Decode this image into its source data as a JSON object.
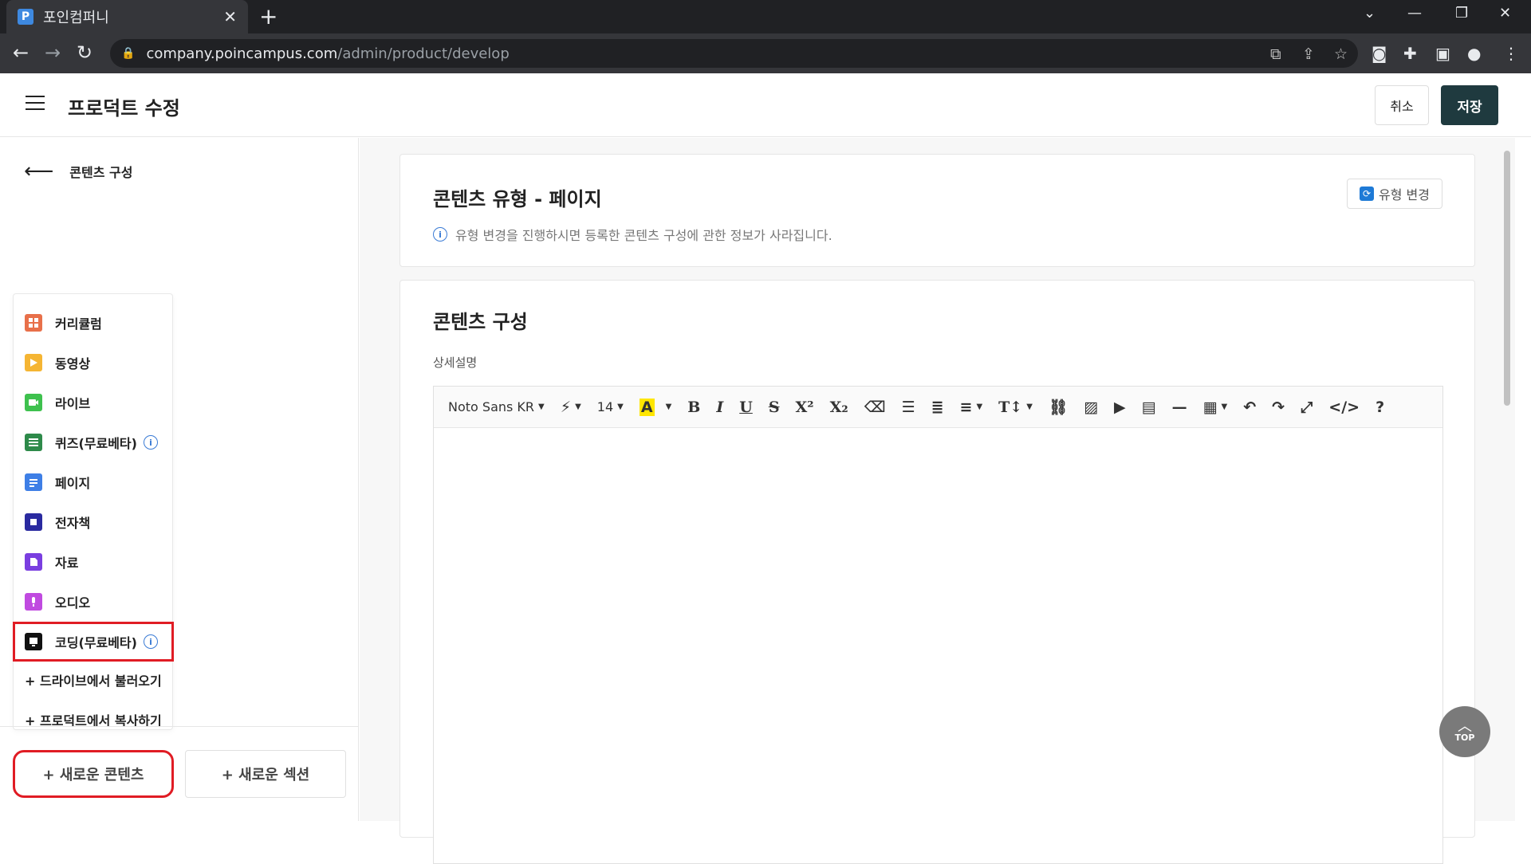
{
  "browser": {
    "tab_title": "포인컴퍼니",
    "favicon_letter": "P",
    "url_domain": "company.poincampus.com",
    "url_path": "/admin/product/develop"
  },
  "header": {
    "title": "프로덕트 수정",
    "cancel_label": "취소",
    "save_label": "저장"
  },
  "sidebar": {
    "back_label": "콘텐츠 구성",
    "items": [
      {
        "label": "커리큘럼",
        "color": "#e8704a"
      },
      {
        "label": "동영상",
        "color": "#f5b533"
      },
      {
        "label": "라이브",
        "color": "#3ec14e"
      },
      {
        "label": "퀴즈(무료베타)",
        "color": "#2e8a4a"
      },
      {
        "label": "페이지",
        "color": "#3e7fe6"
      },
      {
        "label": "전자책",
        "color": "#2a2aa0"
      },
      {
        "label": "자료",
        "color": "#7a3ee0"
      },
      {
        "label": "오디오",
        "color": "#c04ae0"
      },
      {
        "label": "코딩(무료베타)",
        "color": "#111111"
      }
    ],
    "info_mark": "i",
    "action_drive": "+ 드라이브에서 불러오기",
    "action_copy": "+ 프로덕트에서 복사하기",
    "new_content": "+ 새로운 콘텐츠",
    "new_section": "+ 새로운 섹션"
  },
  "content_type": {
    "title": "콘텐츠 유형 - 페이지",
    "change_button": "유형 변경",
    "notice": "유형 변경을 진행하시면 등록한 콘텐츠 구성에 관한 정보가 사라집니다."
  },
  "content_config": {
    "title": "콘텐츠 구성",
    "field_label": "상세설명",
    "toolbar": {
      "font": "Noto Sans KR",
      "size": "14",
      "font_color": "A",
      "bold": "B",
      "italic": "I",
      "underline": "U",
      "strike": "S",
      "superscript": "X²",
      "subscript": "X₂",
      "source_code": "</>",
      "help": "?"
    }
  },
  "top_button": "TOP",
  "colors": {
    "save_bg": "#1f3a3f",
    "highlight": "#e01c24",
    "accent_blue": "#3a7bd5"
  }
}
